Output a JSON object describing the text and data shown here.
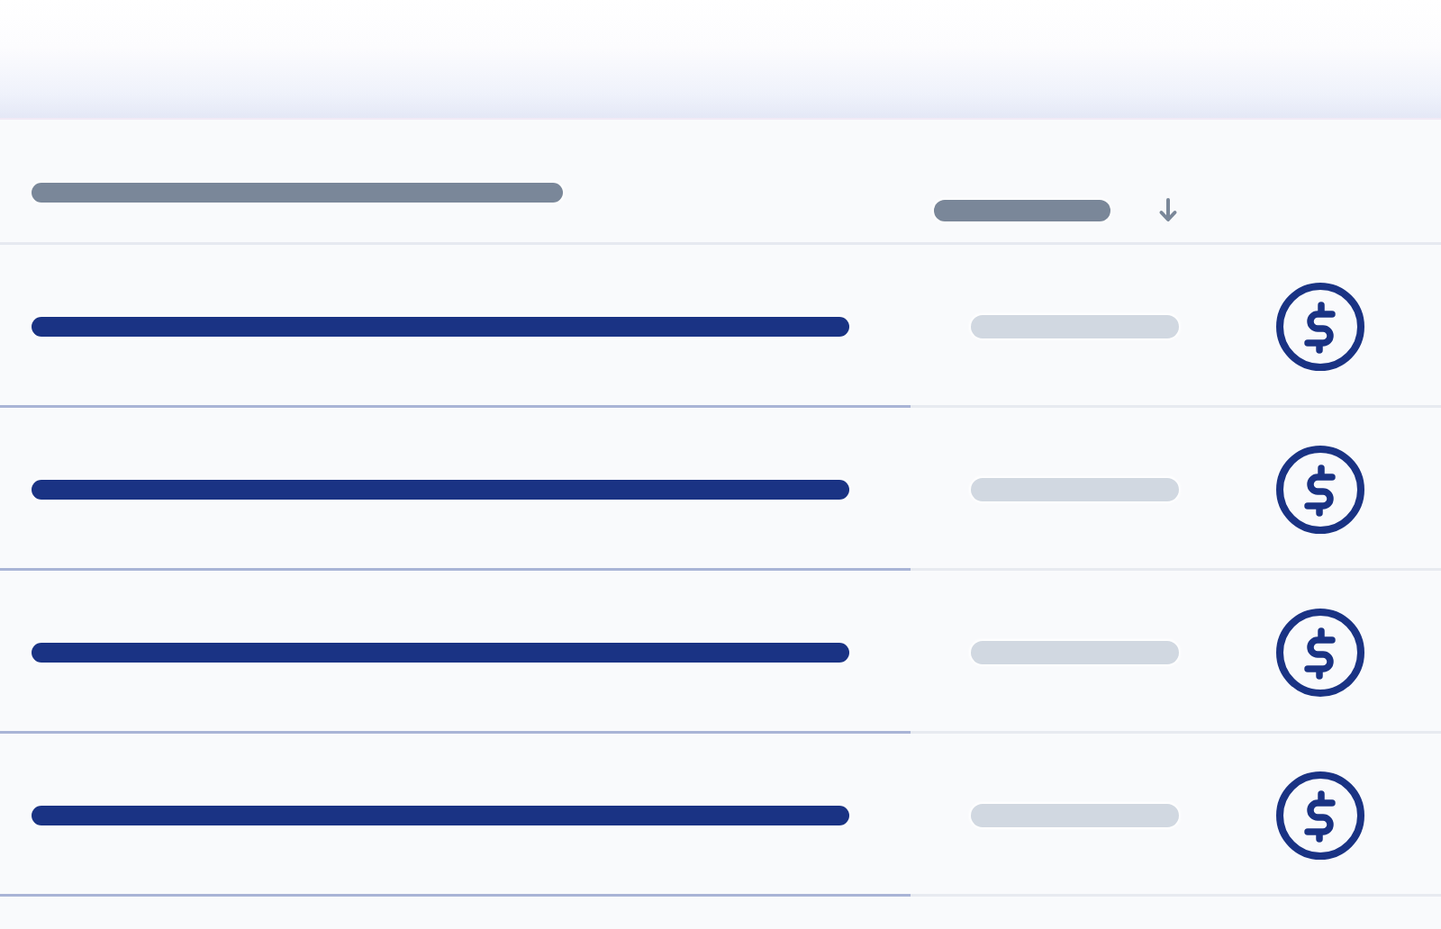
{
  "table": {
    "columns": [
      {
        "sorted": false
      },
      {
        "sorted": true
      }
    ],
    "rows": [
      {
        "kind": "placeholder"
      },
      {
        "kind": "placeholder"
      },
      {
        "kind": "placeholder"
      },
      {
        "kind": "placeholder"
      }
    ]
  }
}
